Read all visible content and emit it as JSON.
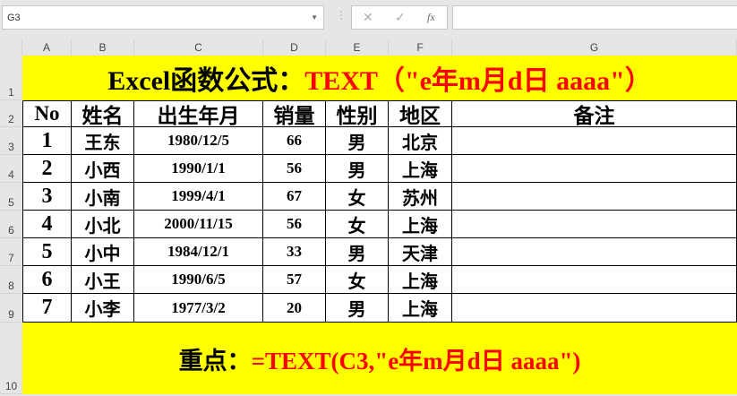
{
  "name_box": "G3",
  "formula_bar": {
    "cancel": "✕",
    "enter": "✓",
    "fx": "fx",
    "value": ""
  },
  "columns": [
    "A",
    "B",
    "C",
    "D",
    "E",
    "F",
    "G"
  ],
  "rows": [
    "1",
    "2",
    "3",
    "4",
    "5",
    "6",
    "7",
    "8",
    "9",
    "10"
  ],
  "title": {
    "black": "Excel函数公式：",
    "red": "TEXT（\"e年m月d日 aaaa\"）"
  },
  "headers": [
    "No",
    "姓名",
    "出生年月",
    "销量",
    "性别",
    "地区",
    "备注"
  ],
  "data": [
    [
      "1",
      "王东",
      "1980/12/5",
      "66",
      "男",
      "北京",
      ""
    ],
    [
      "2",
      "小西",
      "1990/1/1",
      "56",
      "男",
      "上海",
      ""
    ],
    [
      "3",
      "小南",
      "1999/4/1",
      "67",
      "女",
      "苏州",
      ""
    ],
    [
      "4",
      "小北",
      "2000/11/15",
      "56",
      "女",
      "上海",
      ""
    ],
    [
      "5",
      "小中",
      "1984/12/1",
      "33",
      "男",
      "天津",
      ""
    ],
    [
      "6",
      "小王",
      "1990/6/5",
      "57",
      "女",
      "上海",
      ""
    ],
    [
      "7",
      "小李",
      "1977/3/2",
      "20",
      "男",
      "上海",
      ""
    ]
  ],
  "footer": {
    "black": "重点：",
    "red": "=TEXT(C3,\"e年m月d日 aaaa\")"
  }
}
